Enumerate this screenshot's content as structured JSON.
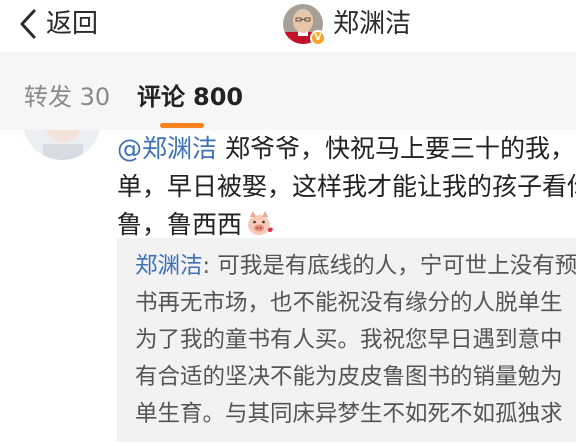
{
  "nav": {
    "back_label": "返回",
    "user_name": "郑渊洁",
    "verified_badge": "V"
  },
  "tabs": {
    "repost_label": "转发",
    "repost_count": "30",
    "comments_label": "评论",
    "comments_count": "800"
  },
  "comment": {
    "mention": "@郑渊洁",
    "lines": [
      "郑爷爷，快祝马上要三十的我，早",
      "单，早日被娶，这样我才能让我的孩子看你",
      "鲁，鲁西西"
    ],
    "emoji": "pig-emoji"
  },
  "reply": {
    "author": "郑渊洁",
    "lines": [
      ": 可我是有底线的人，宁可世上没有预",
      "书再无市场，也不能祝没有缘分的人脱单生",
      "为了我的童书有人买。我祝您早日遇到意中",
      "有合适的坚决不能为皮皮鲁图书的销量勉为",
      "单生育。与其同床异梦生不如死不如孤独求"
    ]
  },
  "colors": {
    "accent": "#f5811f",
    "link": "#3f71b5",
    "tab_bg": "#f6f6f6",
    "quote_bg": "#f2f2f2"
  }
}
